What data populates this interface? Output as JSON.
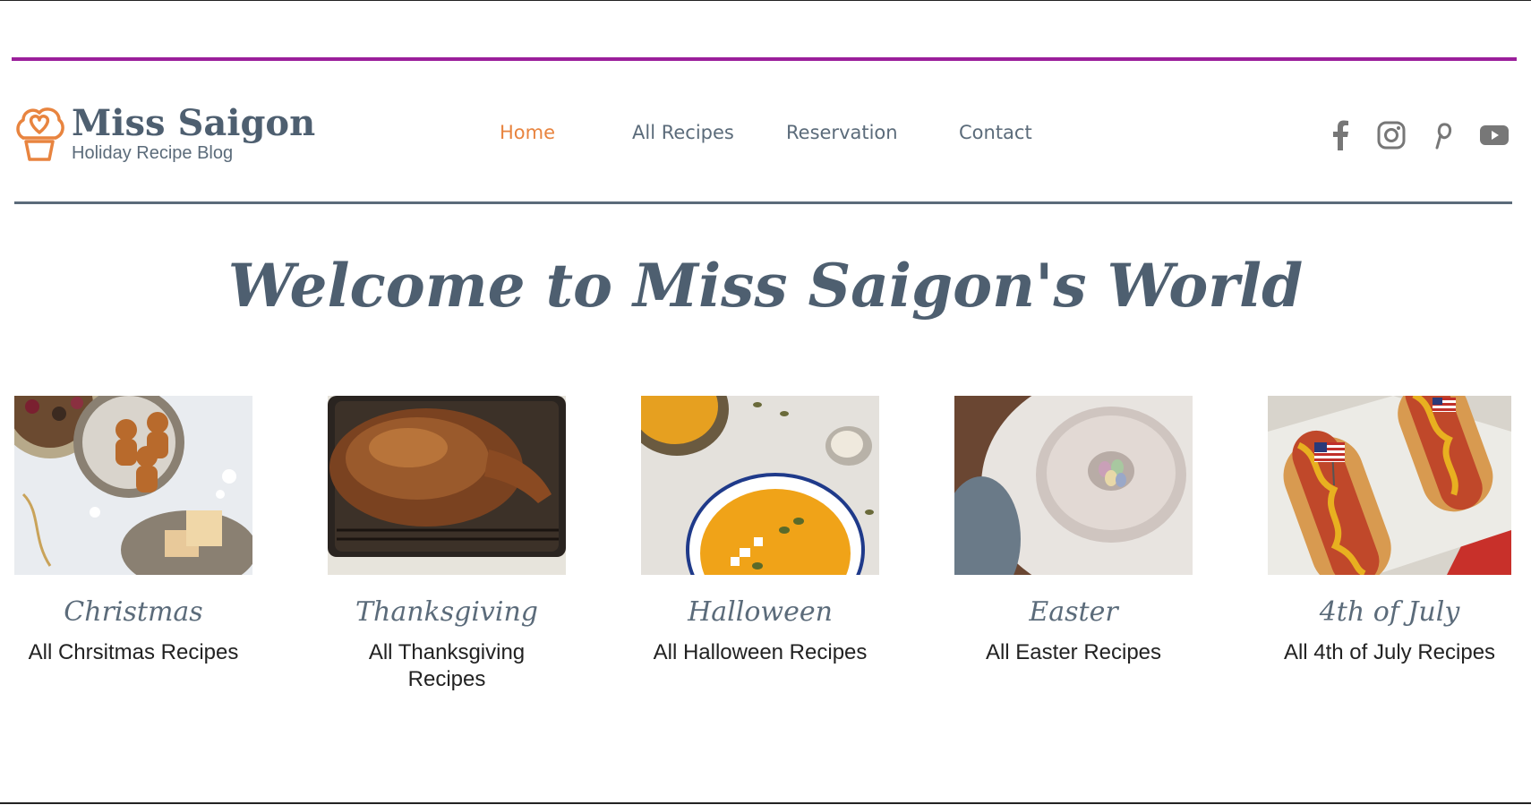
{
  "brand": {
    "name": "Miss Saigon",
    "tagline": "Holiday Recipe Blog",
    "icon": "cupcake-heart-icon",
    "logo_color": "#e8843f",
    "text_color": "#4e5f70"
  },
  "nav": {
    "items": [
      {
        "label": "Home",
        "active": true
      },
      {
        "label": "All Recipes",
        "active": false
      },
      {
        "label": "Reservation",
        "active": false
      },
      {
        "label": "Contact",
        "active": false
      }
    ],
    "active_color": "#e8843f",
    "color": "#5b6b7a"
  },
  "social": [
    "facebook-icon",
    "instagram-icon",
    "pinterest-icon",
    "youtube-icon"
  ],
  "colors": {
    "accent_bar": "#9b1f9b",
    "header_rule": "#5b6b7a"
  },
  "hero": {
    "title": "Welcome to Miss Saigon's World"
  },
  "categories": [
    {
      "title": "Christmas",
      "link": "All Chrsitmas Recipes",
      "image": "gingerbread-cookies-image"
    },
    {
      "title": "Thanksgiving",
      "link": "All Thanksgiving Recipes",
      "image": "roast-turkey-image"
    },
    {
      "title": "Halloween",
      "link": "All Halloween Recipes",
      "image": "pumpkin-soup-image"
    },
    {
      "title": "Easter",
      "link": "All Easter Recipes",
      "image": "easter-bundt-cake-image"
    },
    {
      "title": "4th of July",
      "link": "All 4th of July Recipes",
      "image": "hot-dogs-flag-image"
    }
  ]
}
